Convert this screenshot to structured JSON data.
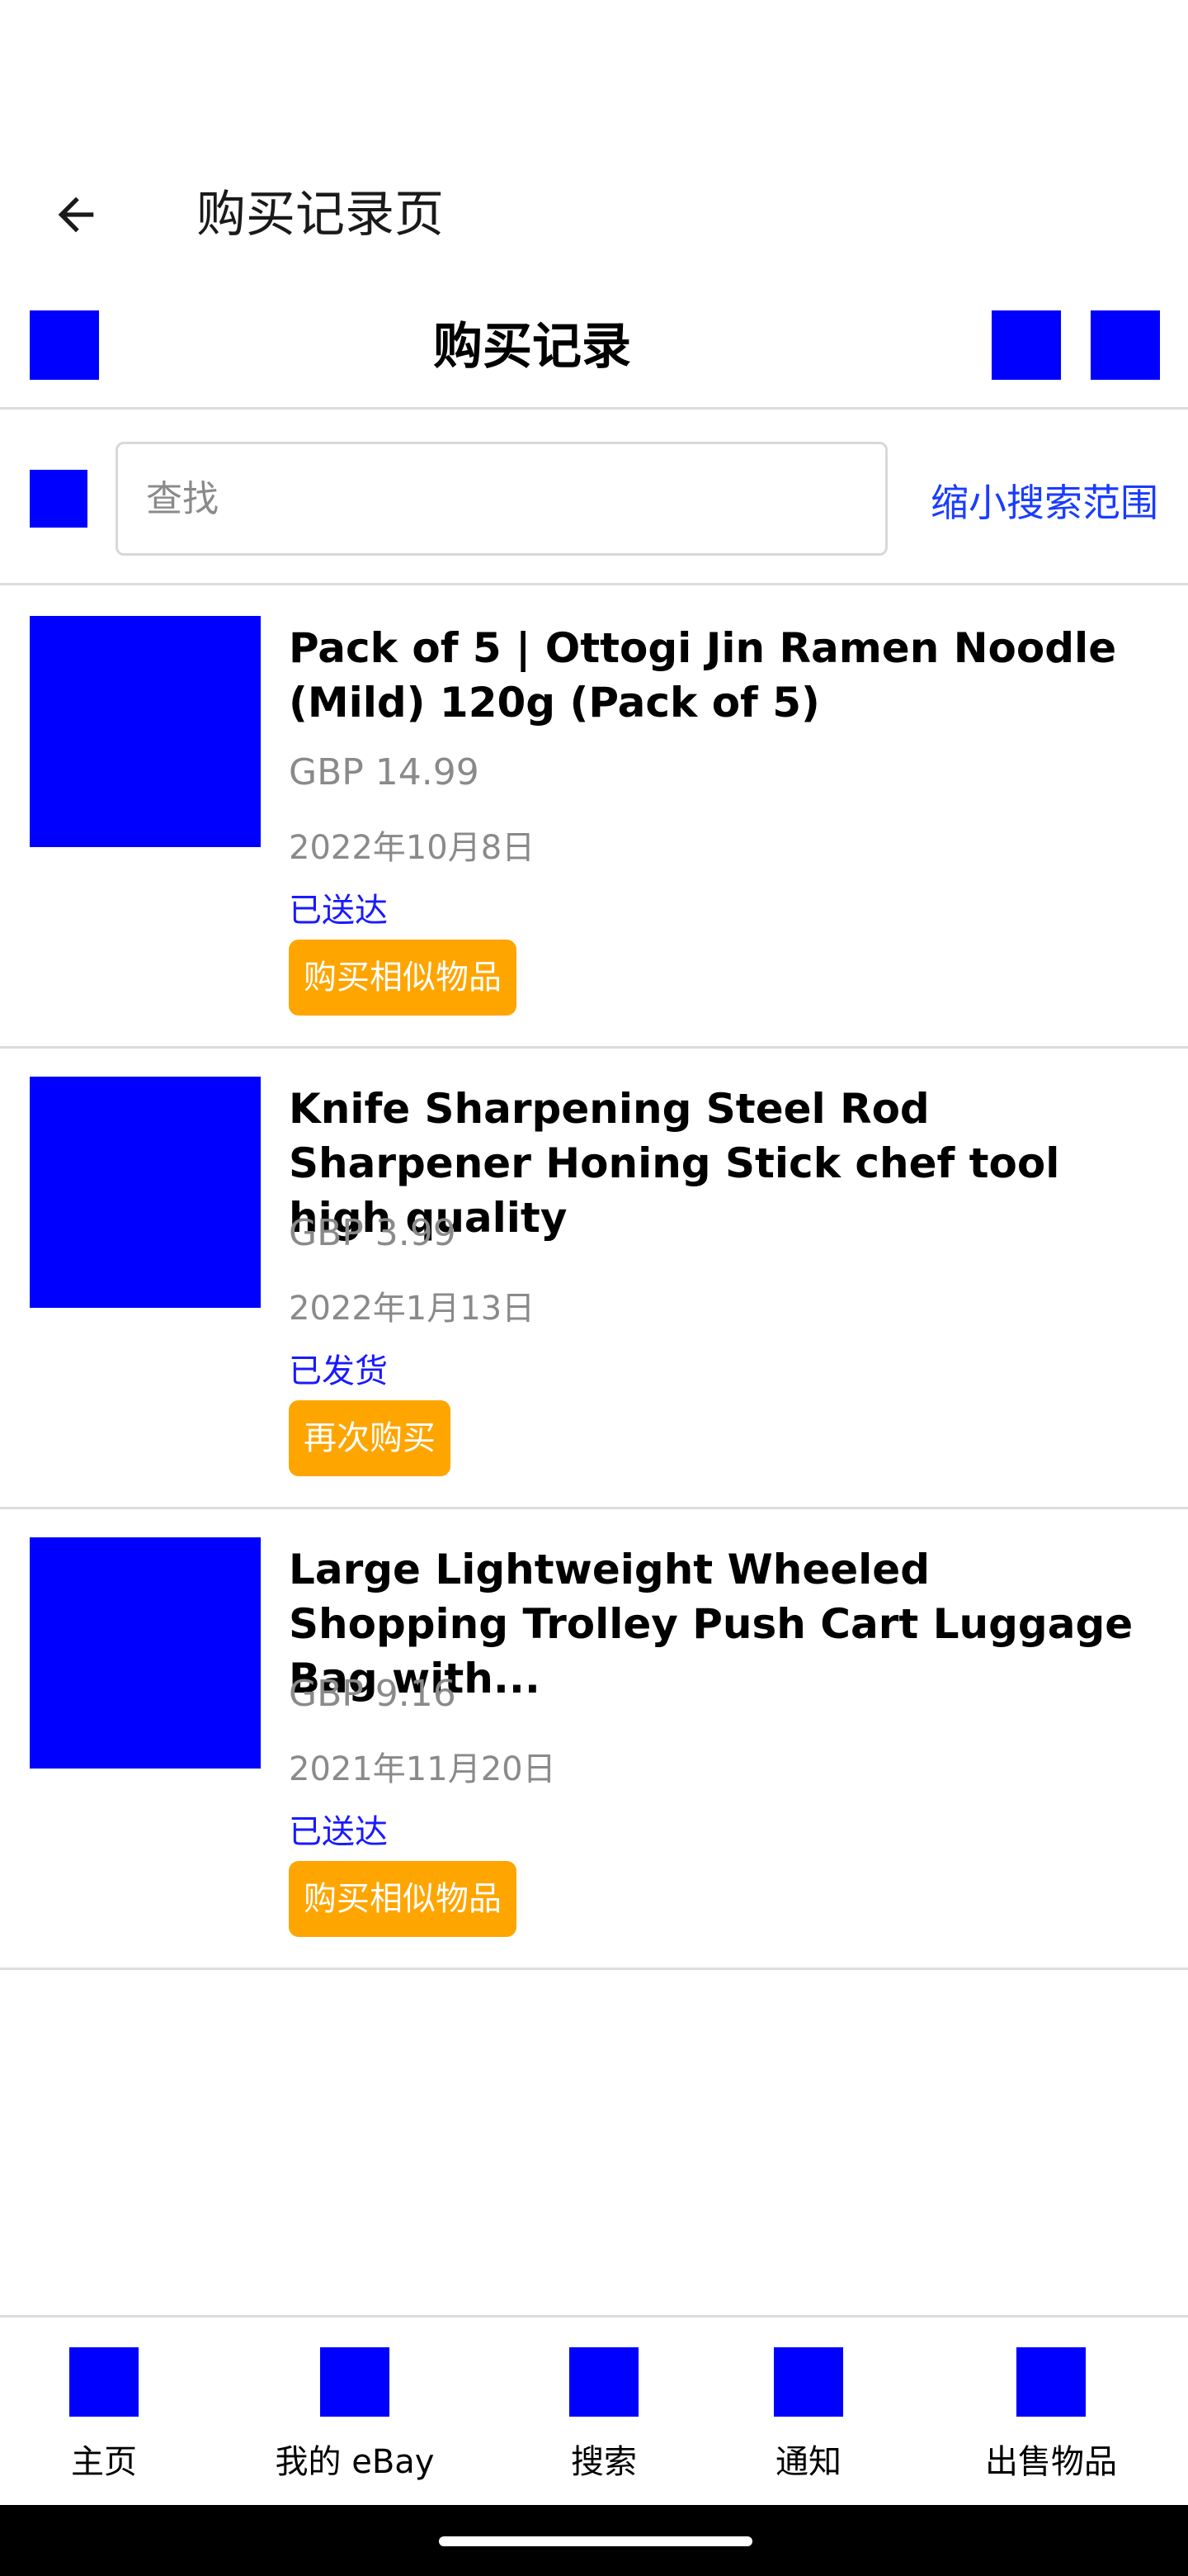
{
  "app_bar": {
    "title": "购买记录页",
    "back_icon": "arrow-left-icon"
  },
  "section": {
    "title": "购买记录"
  },
  "search": {
    "placeholder": "查找",
    "refine_label": "缩小搜索范围"
  },
  "items": [
    {
      "title": "Pack of 5 | Ottogi Jin Ramen Noodle (Mild) 120g (Pack of 5)",
      "price": "GBP 14.99",
      "date": "2022年10月8日",
      "status": "已送达",
      "action": "购买相似物品"
    },
    {
      "title": "Knife Sharpening Steel Rod Sharpener Honing Stick chef tool high quality",
      "price": "GBP 3.99",
      "date": "2022年1月13日",
      "status": "已发货",
      "action": "再次购买"
    },
    {
      "title": "Large Lightweight Wheeled Shopping Trolley Push Cart Luggage Bag with...",
      "price": "GBP 9.16",
      "date": "2021年11月20日",
      "status": "已送达",
      "action": "购买相似物品"
    }
  ],
  "bottom_nav": [
    {
      "label": "主页"
    },
    {
      "label": "我的 eBay"
    },
    {
      "label": "搜索"
    },
    {
      "label": "通知"
    },
    {
      "label": "出售物品"
    }
  ],
  "colors": {
    "accent_blue": "#0000ff",
    "link_blue": "#1a3cff",
    "button_orange": "#ffa500",
    "muted_gray": "#8a8a8a"
  }
}
